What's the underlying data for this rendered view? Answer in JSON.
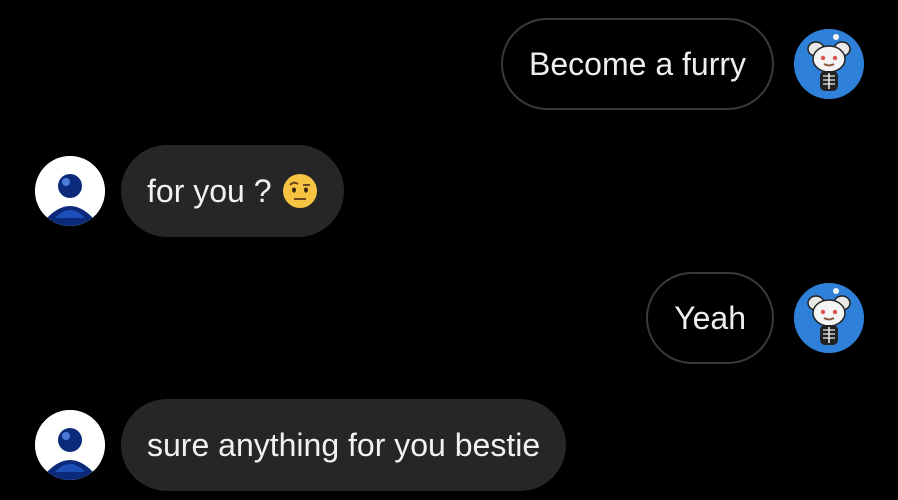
{
  "colors": {
    "background": "#000000",
    "sent_bubble_border": "#3a3a3a",
    "received_bubble": "#262626",
    "my_avatar_bg": "#2f80d8",
    "their_avatar_bg": "#ffffff"
  },
  "messages": [
    {
      "sender": "me",
      "text": "Become a furry",
      "avatar": "snoo-avatar"
    },
    {
      "sender": "them",
      "text": "for you ?",
      "emoji": "raised-eyebrow-emoji",
      "avatar": "default-avatar"
    },
    {
      "sender": "me",
      "text": "Yeah",
      "avatar": "snoo-avatar"
    },
    {
      "sender": "them",
      "text": "sure anything for you bestie",
      "avatar": "default-avatar"
    }
  ]
}
